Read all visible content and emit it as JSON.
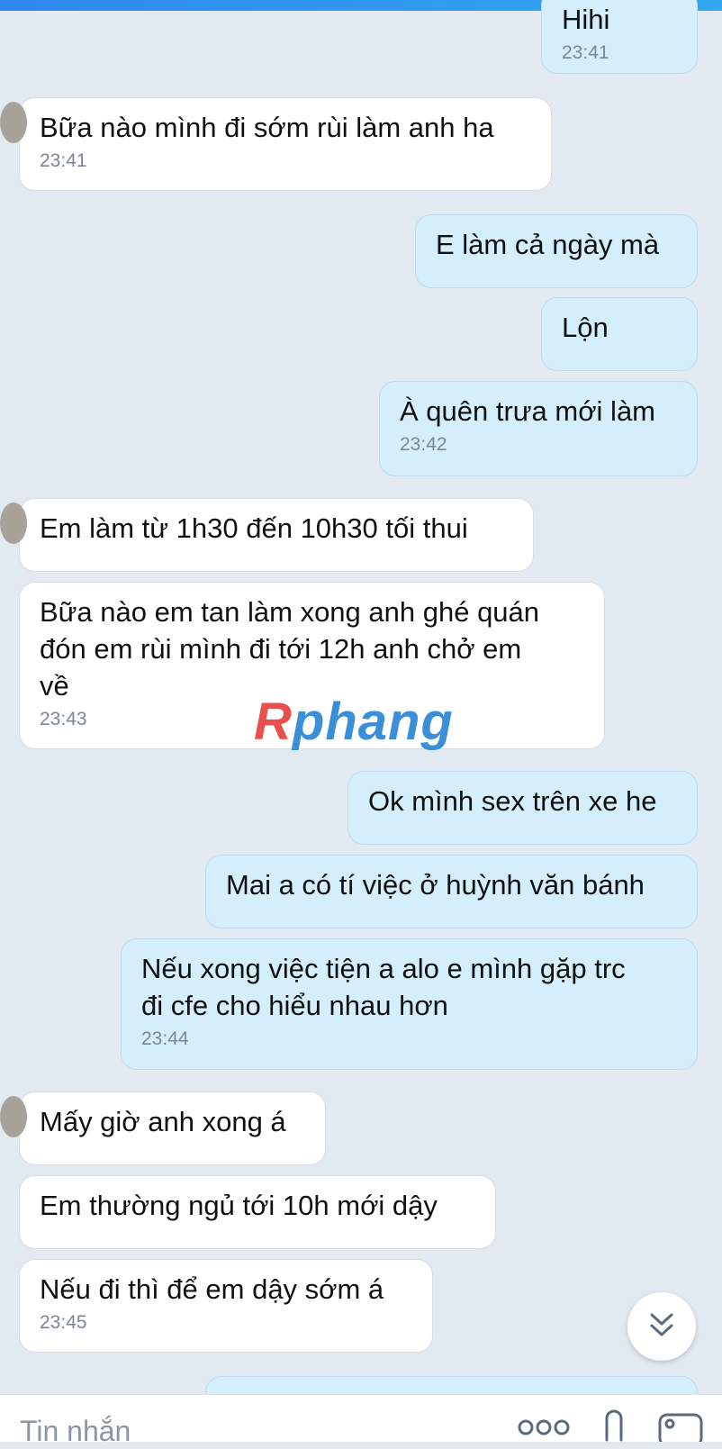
{
  "messages": [
    {
      "side": "out",
      "text": "Hihi",
      "time": "23:41"
    },
    {
      "side": "in",
      "text": "Bữa nào mình đi sớm rùi làm anh ha",
      "time": "23:41"
    },
    {
      "side": "out",
      "text": "E làm cả ngày mà"
    },
    {
      "side": "out",
      "text": "Lộn"
    },
    {
      "side": "out",
      "text": "À quên trưa mới làm",
      "time": "23:42"
    },
    {
      "side": "in",
      "text": "Em làm từ 1h30 đến 10h30 tối thui"
    },
    {
      "side": "in",
      "lines": [
        "Bữa nào em tan làm xong anh ghé quán",
        "đón em rùi mình đi tới 12h anh chở em",
        "về"
      ],
      "time": "23:43"
    },
    {
      "side": "out",
      "text": "Ok mình sex trên xe he"
    },
    {
      "side": "out",
      "text": "Mai a có tí việc ở huỳnh văn bánh"
    },
    {
      "side": "out",
      "lines": [
        "Nếu xong việc tiện a alo e mình gặp trc",
        "đi cfe cho hiểu nhau hơn"
      ],
      "time": "23:44"
    },
    {
      "side": "in",
      "text": "Mấy giờ anh xong á"
    },
    {
      "side": "in",
      "text": "Em thường ngủ tới 10h mới dậy"
    },
    {
      "side": "in",
      "text": "Nếu đi thì để em dậy sớm á",
      "time": "23:45"
    }
  ],
  "watermark": {
    "part1": "R",
    "part2": "phang"
  },
  "composer": {
    "placeholder": "Tin nhắn"
  },
  "icons": {
    "scroll_down": "double-chevron-down-icon",
    "emoji": "emoji-icon",
    "attach": "paperclip-icon",
    "image": "image-icon"
  },
  "colors": {
    "background": "#e2e9f1",
    "incoming_bubble": "#ffffff",
    "outgoing_bubble": "#d4eefc",
    "timestamp": "#7c8794",
    "topbar": "#2f87ee"
  }
}
